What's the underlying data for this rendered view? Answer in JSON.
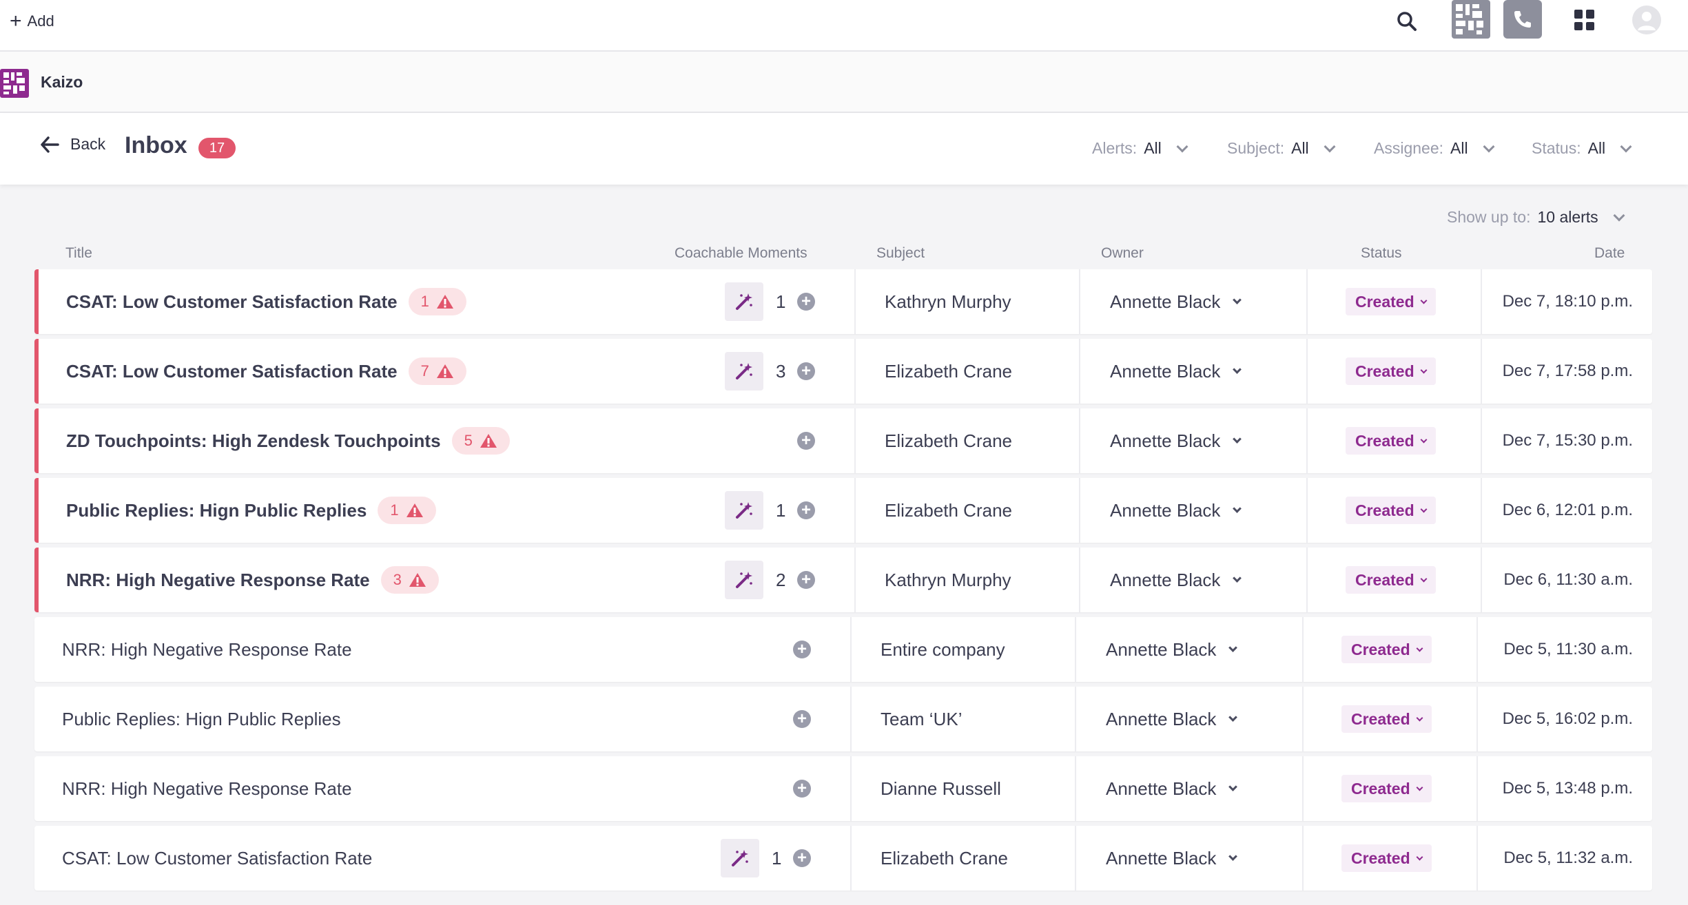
{
  "topbar": {
    "add_label": "Add"
  },
  "workspace": {
    "name": "Kaizo"
  },
  "header": {
    "back_label": "Back",
    "title": "Inbox",
    "count": "17",
    "filters": [
      {
        "label": "Alerts:",
        "value": "All"
      },
      {
        "label": "Subject:",
        "value": "All"
      },
      {
        "label": "Assignee:",
        "value": "All"
      },
      {
        "label": "Status:",
        "value": "All"
      }
    ],
    "show_up_to_label": "Show up to:",
    "show_up_to_value": "10 alerts"
  },
  "columns": {
    "title": "Title",
    "coachable": "Coachable Moments",
    "subject": "Subject",
    "owner": "Owner",
    "status": "Status",
    "date": "Date"
  },
  "colors": {
    "alert": "#e2566c",
    "brand": "#8e2a8f"
  },
  "rows": [
    {
      "title": "CSAT: Low Customer Satisfaction Rate",
      "alerts": "1",
      "moments": "1",
      "subject": "Kathryn Murphy",
      "owner": "Annette Black",
      "status": "Created",
      "date": "Dec 7, 18:10 p.m."
    },
    {
      "title": "CSAT: Low Customer Satisfaction Rate",
      "alerts": "7",
      "moments": "3",
      "subject": "Elizabeth Crane",
      "owner": "Annette Black",
      "status": "Created",
      "date": "Dec 7, 17:58 p.m."
    },
    {
      "title": "ZD Touchpoints: High Zendesk Touchpoints",
      "alerts": "5",
      "moments": "",
      "subject": "Elizabeth Crane",
      "owner": "Annette Black",
      "status": "Created",
      "date": "Dec 7, 15:30 p.m."
    },
    {
      "title": "Public Replies: Hign Public Replies",
      "alerts": "1",
      "moments": "1",
      "subject": "Elizabeth Crane",
      "owner": "Annette Black",
      "status": "Created",
      "date": "Dec 6, 12:01 p.m."
    },
    {
      "title": "NRR: High Negative Response Rate",
      "alerts": "3",
      "moments": "2",
      "subject": "Kathryn Murphy",
      "owner": "Annette Black",
      "status": "Created",
      "date": "Dec 6, 11:30 a.m."
    },
    {
      "title": "NRR: High Negative Response Rate",
      "alerts": "",
      "moments": "",
      "subject": "Entire company",
      "owner": "Annette Black",
      "status": "Created",
      "date": "Dec 5, 11:30 a.m."
    },
    {
      "title": "Public Replies: Hign Public Replies",
      "alerts": "",
      "moments": "",
      "subject": "Team ‘UK’",
      "owner": "Annette Black",
      "status": "Created",
      "date": "Dec 5, 16:02 p.m."
    },
    {
      "title": "NRR: High Negative Response Rate",
      "alerts": "",
      "moments": "",
      "subject": "Dianne Russell",
      "owner": "Annette Black",
      "status": "Created",
      "date": "Dec 5, 13:48 p.m."
    },
    {
      "title": "CSAT: Low Customer Satisfaction Rate",
      "alerts": "",
      "moments": "1",
      "subject": "Elizabeth Crane",
      "owner": "Annette Black",
      "status": "Created",
      "date": "Dec 5, 11:32 a.m."
    }
  ]
}
